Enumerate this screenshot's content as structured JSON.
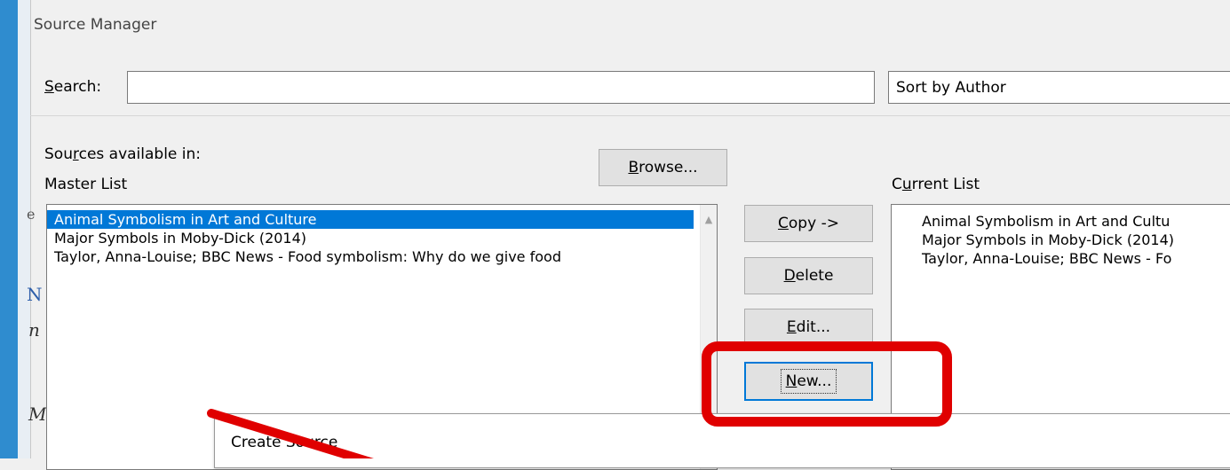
{
  "window": {
    "title": "Source Manager"
  },
  "search": {
    "label_prefix": "",
    "label_accel": "S",
    "label_rest": "earch:",
    "value": ""
  },
  "sort": {
    "selected": "Sort by Author"
  },
  "sources_available": {
    "label_pre": "Sou",
    "label_accel": "r",
    "label_post": "ces available in:",
    "location": "Master List"
  },
  "browse": {
    "accel": "B",
    "rest": "rowse..."
  },
  "current_list": {
    "label_pre": "C",
    "label_accel": "u",
    "label_post": "rrent List"
  },
  "master_list": {
    "items": [
      "Animal Symbolism in Art and Culture",
      "Major Symbols in Moby-Dick (2014)",
      "Taylor, Anna-Louise; BBC News - Food symbolism: Why do we give food"
    ],
    "selected_index": 0
  },
  "current_items": [
    "Animal Symbolism in Art and Cultu",
    "Major Symbols in Moby-Dick (2014)",
    "Taylor, Anna-Louise; BBC News - Fo"
  ],
  "buttons": {
    "copy": {
      "accel": "C",
      "rest": "opy ->"
    },
    "delete": {
      "accel": "D",
      "rest": "elete"
    },
    "edit": {
      "accel": "E",
      "rest": "dit..."
    },
    "new": {
      "accel": "N",
      "rest": "ew..."
    }
  },
  "popup": {
    "title": "Create Source"
  },
  "annotation": {
    "highlight_color": "#e00000",
    "arrow_color": "#e00000"
  },
  "background_glyphs": [
    "e",
    "N",
    "n",
    "Mi"
  ]
}
